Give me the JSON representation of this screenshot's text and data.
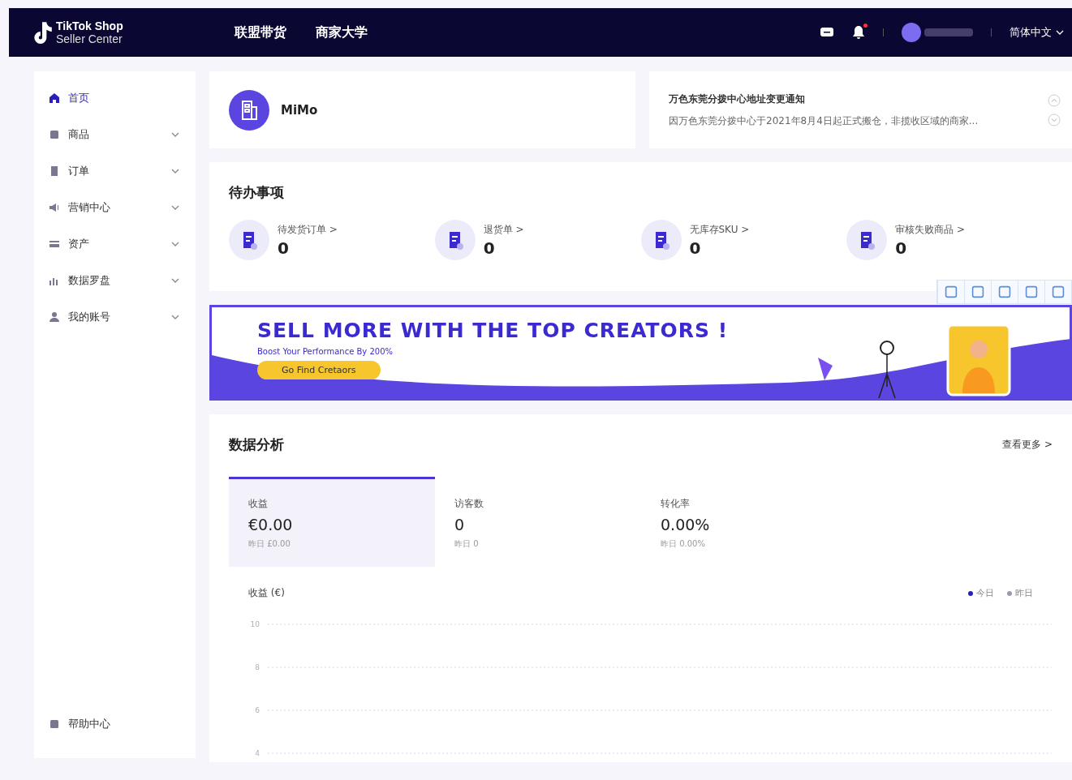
{
  "header": {
    "logo_line1": "TikTok Shop",
    "logo_line2": "Seller Center",
    "nav": [
      {
        "label": "联盟带货"
      },
      {
        "label": "商家大学"
      }
    ],
    "notification_dot": true,
    "language": "简体中文"
  },
  "sidebar": {
    "items": [
      {
        "label": "首页",
        "selected": true,
        "has_submenu": false
      },
      {
        "label": "商品",
        "selected": false,
        "has_submenu": true
      },
      {
        "label": "订单",
        "selected": false,
        "has_submenu": true
      },
      {
        "label": "营销中心",
        "selected": false,
        "has_submenu": true
      },
      {
        "label": "资产",
        "selected": false,
        "has_submenu": true
      },
      {
        "label": "数据罗盘",
        "selected": false,
        "has_submenu": true
      },
      {
        "label": "我的账号",
        "selected": false,
        "has_submenu": true
      }
    ],
    "footer": {
      "label": "帮助中心"
    }
  },
  "shop": {
    "name": "MiMo"
  },
  "notice": {
    "title": "万色东莞分拨中心地址变更通知",
    "body": "因万色东莞分拨中心于2021年8月4日起正式搬仓，非揽收区域的商家..."
  },
  "todo": {
    "title": "待办事项",
    "items": [
      {
        "label": "待发货订单 >",
        "count": "0"
      },
      {
        "label": "退货单 >",
        "count": "0"
      },
      {
        "label": "无库存SKU >",
        "count": "0"
      },
      {
        "label": "审核失败商品 >",
        "count": "0"
      }
    ]
  },
  "banner": {
    "headline": "SELL MORE WITH THE TOP CREATORS !",
    "subtitle": "Boost Your Performance By 200%",
    "button": "Go Find Cretaors"
  },
  "analytics": {
    "title": "数据分析",
    "more": "查看更多 >",
    "metrics": [
      {
        "label": "收益",
        "value": "€0.00",
        "previous": "昨日 £0.00",
        "selected": true
      },
      {
        "label": "访客数",
        "value": "0",
        "previous": "昨日 0",
        "selected": false
      },
      {
        "label": "转化率",
        "value": "0.00%",
        "previous": "昨日 0.00%",
        "selected": false
      }
    ],
    "chart_data": {
      "type": "line",
      "title": "收益 (€)",
      "ylim": [
        4,
        10
      ],
      "grid": true,
      "yticks": [
        10,
        8,
        6,
        4
      ],
      "series": [
        {
          "name": "今日",
          "color": "#2a1fb8"
        },
        {
          "name": "昨日",
          "color": "#9a9aa8"
        }
      ]
    }
  }
}
